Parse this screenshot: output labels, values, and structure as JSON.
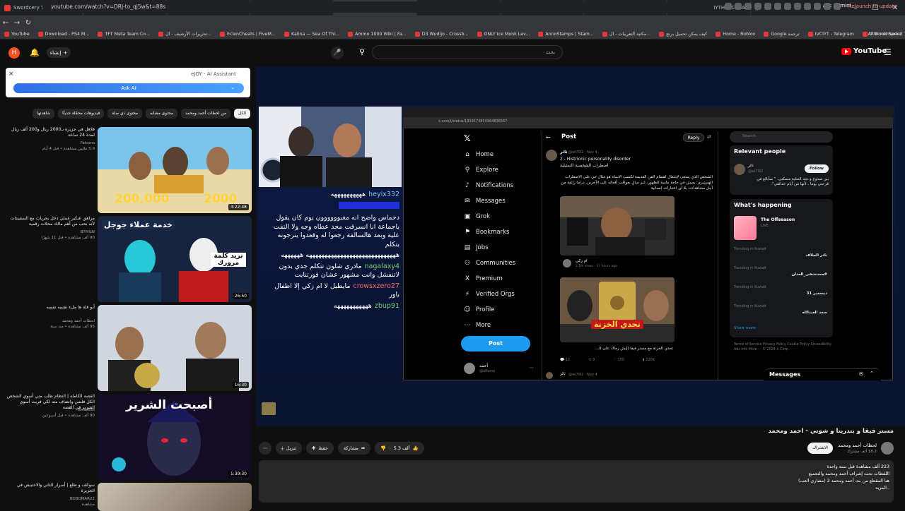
{
  "browser": {
    "tabs": [
      {
        "label": "Swordcery TROPHY - YouTube",
        "active": false
      },
      {
        "label": "YouTube - لحظات أحمد ومحمد",
        "active": false
      },
      {
        "label": "أذكى خطة من الإنترنل للإيقاع بك",
        "active": false
      },
      {
        "label": "القصة الكاملة | النظام طلب منّي",
        "active": false
      },
      {
        "label": "مستر فيقا و بتدريتا و شوتي",
        "active": true
      },
      {
        "label": "obs - لحظات أحمد ومحمد",
        "active": false
      },
      {
        "label": "منتدى حاكمي | أحمد ومحمد",
        "active": false
      },
      {
        "label": "Sword of the Sea - All Collecti",
        "active": false
      },
      {
        "label": "How to find MYTHIC CHEAT CO",
        "active": false
      }
    ],
    "new_tab": "+",
    "ask_gemini": "Ask Gemini",
    "url": "youtube.com/watch?v=DRJ-to_qj5w&t=88s",
    "relaunch": "Relaunch to update",
    "bookmarks": [
      "YouTube",
      "Download - PS4 M...",
      "TFT Meta Team Co...",
      "تحريرات الأرشيف - ال...",
      "EclenCheats | FiveM...",
      "Kalina — Sea Of Thi...",
      "Ammo 1000 Wiki | Fa...",
      "D3 Wudijo - Crossb...",
      "ONLY Ice Monk Lev...",
      "AnnoStamps | Stam...",
      "مكتبة التعريبات - ال...",
      "كيف يمكن تحميل برنج",
      "Home - Roblox",
      "Google ترجمة",
      "IVCIYT - Telegram",
      "Internet Speed Test..."
    ],
    "all_bookmarks": "All Bookmarks"
  },
  "youtube": {
    "avatar_letter": "H",
    "create_label": "إنشاء",
    "search_placeholder": "بحث",
    "logo": "YouTube"
  },
  "ai": {
    "title": "eJOY - AI Assistant",
    "button": "Ask AI",
    "close": "×"
  },
  "chips": [
    {
      "label": "الكل",
      "on": true
    },
    {
      "label": "من لحظات أحمد ومحمد",
      "on": false
    },
    {
      "label": "محتوى مشابه",
      "on": false
    },
    {
      "label": "محتوى ذي صلة",
      "on": false
    },
    {
      "label": "فيديوهات محمّلة حديثًا",
      "on": false
    },
    {
      "label": "شاهدتها",
      "on": false
    }
  ],
  "recommendations": [
    {
      "title": "فلافل في جزيرة بـ2000 ريال و200 ألف ريال لمدة 24 ساعة",
      "channel": "Falcons",
      "meta": "5.9 ملايين مشاهدة • قبل 4 أيام",
      "duration": "3:22:48",
      "thumb_a": "200,000",
      "thumb_b": "2000"
    },
    {
      "title": "مراهق عنكبر عملي دخل بحريات مع السفينتات لأنه نحب من أهم مالك محلات رقمية",
      "channel": "B7M&N",
      "meta": "90 ألف مشاهدة • قبل 11 شهرًا",
      "duration": "26:50",
      "thumb_a": "خدمة عملاء جوجل",
      "thumb_b": "نريد كلمة مرورك"
    },
    {
      "title": "أبو فلة ها ملء نفسه نفسه",
      "channel": "لحظات أحمد ومحمد",
      "meta": "95 ألف مشاهدة • منذ سنة",
      "duration": "16:30",
      "thumb_a": "",
      "thumb_b": ""
    },
    {
      "title": "القصة الكاملة | النظام طلب مني أسوي الشخص الكل فلتس وانضاف مته لكي فريت أسوي الشرير في القصة",
      "channel": "Relaxess",
      "meta": "90 ألف مشاهدة • قبل أسبوعين",
      "duration": "1:39:30",
      "thumb_a": "أصبحت الشرير",
      "thumb_b": ""
    },
    {
      "title": "سوالف و طلع | أسرار التاتي والاختبيص في الجزيرة",
      "channel": "BO3OMAR22",
      "meta": "مشاهدة",
      "duration": "",
      "thumb_a": "",
      "thumb_b": ""
    }
  ],
  "stream": {
    "chat": [
      {
        "user": "heyix332",
        "text": "ههههههههههه",
        "cls": "n1"
      },
      {
        "user": "",
        "text": "",
        "cls": "n4"
      },
      {
        "user": "",
        "text": "دحماس واضح انه مغبوووووون يوم كان يقول ياجماعة انا انسرقت محد عطاه وجه ولا التفت عليه وبعد هالسالفة رجعوا له وقعدوا يترجونه يتكلم",
        "cls": "msg"
      },
      {
        "user": "",
        "text": "هههههههههههههههههههههههههههههه ههههههه",
        "cls": "msg"
      },
      {
        "user": "nagalaxy4",
        "text": "مادري شلون تتكلم جدي بدون لاتنفشل وانت مشهور عشان فورتنايت",
        "cls": "n2"
      },
      {
        "user": "crowsxzero27",
        "text": "مايطبل لا ام زكي إلا اطفال باور",
        "cls": "n3"
      },
      {
        "user": "zbup91",
        "text": "هههههههههههه",
        "cls": "n2"
      }
    ]
  },
  "twitter": {
    "url": "x.com/i/status/1833574854964836567",
    "nav": [
      {
        "label": "Home",
        "icon": "⌂"
      },
      {
        "label": "Explore",
        "icon": "⚲"
      },
      {
        "label": "Notifications",
        "icon": "♪"
      },
      {
        "label": "Messages",
        "icon": "✉"
      },
      {
        "label": "Grok",
        "icon": "▣"
      },
      {
        "label": "Bookmarks",
        "icon": "⚑"
      },
      {
        "label": "Jobs",
        "icon": "▤"
      },
      {
        "label": "Communities",
        "icon": "⚇"
      },
      {
        "label": "Premium",
        "icon": "X"
      },
      {
        "label": "Verified Orgs",
        "icon": "⚡"
      },
      {
        "label": "Profile",
        "icon": "☺"
      },
      {
        "label": "More",
        "icon": "⋯"
      }
    ],
    "post_button": "Post",
    "user_name": "أحمد",
    "user_handle": "@afhimp",
    "header": "Post",
    "reply_button": "Reply",
    "post_author": "ثائر",
    "post_handle": "@wi7l92 · Nov 4",
    "post_line1": "2 - Histrionic personality disorder",
    "post_line2": "اضطراب الشخصية التمثيلية",
    "post_body": "الشخص الذي يسعى لإشغال اهتمام الفن القديمة لكسب الانتباه هو مثال حي على الاضطراب الهستيري؛ يعيش في حاجة ماسة للظهور، غير مبالٍ بعواقب أفعاله على الآخرين. دراما زائفة من أجل مشاهدات، بلا أي اعتبارات إنسانية",
    "quote_name": "ام زكي",
    "quote_meta": "2.1M views · 17 hours ago",
    "video_badge": "تحدي الخزنة",
    "video_caption": "تحدي الخزنة مع مستر فيقا (إيش رماك على الـ...",
    "post_stats": {
      "replies": "12",
      "reposts": "9",
      "likes": "780",
      "views": "220K"
    },
    "next_author": "ثائر",
    "next_meta": "@wi7l92 · Nov 4",
    "search_placeholder": "Search",
    "relevant_title": "Relevant people",
    "relevant_name": "ثائر",
    "relevant_handle": "@wi7l92",
    "relevant_bio": "بين مبدوع و نجد العناية مسكني. \" سأبالغ في فرحتي يوما ..لأنها من أيام حدائقي\".",
    "follow": "Follow",
    "happening_title": "What's happening",
    "happening_event": "The Offseason",
    "happening_live": "LIVE",
    "trends": [
      {
        "ctx": "Trending in Kuwait",
        "name": "نادر الجلاف"
      },
      {
        "ctx": "Trending in Kuwait",
        "name": "#مستشفى_العدان"
      },
      {
        "ctx": "Trending in Kuwait",
        "name": "ديسمبر 31"
      },
      {
        "ctx": "Trending in Kuwait",
        "name": "سعد العبدالله"
      }
    ],
    "show_more": "Show more",
    "footer": "Terms of Service   Privacy Policy   Cookie Policy   Accessibility   Ads info   More ···   © 2024 X Corp.",
    "messages": "Messages"
  },
  "video": {
    "title": "مستر فيقا و بتدريتا و شوتي - احمد ومحمد",
    "channel_name": "لحظات أحمد ومحمد",
    "channel_subs": "18.2 ألف مشترك",
    "join": "الاشتراك",
    "likes": "5.3 ألف",
    "dislike": "",
    "share": "مشاركة",
    "save": "حفظ",
    "clip": "تنزيل",
    "description": [
      "223 ألف مشاهدة  قبل سنة واحدة",
      "اللقطات تحت إشراف أحمد ومحمد والتجميع",
      "هنا المقطع من بث أحمد ومحمد 2  (مشاري العب)",
      "..المزيد"
    ]
  }
}
